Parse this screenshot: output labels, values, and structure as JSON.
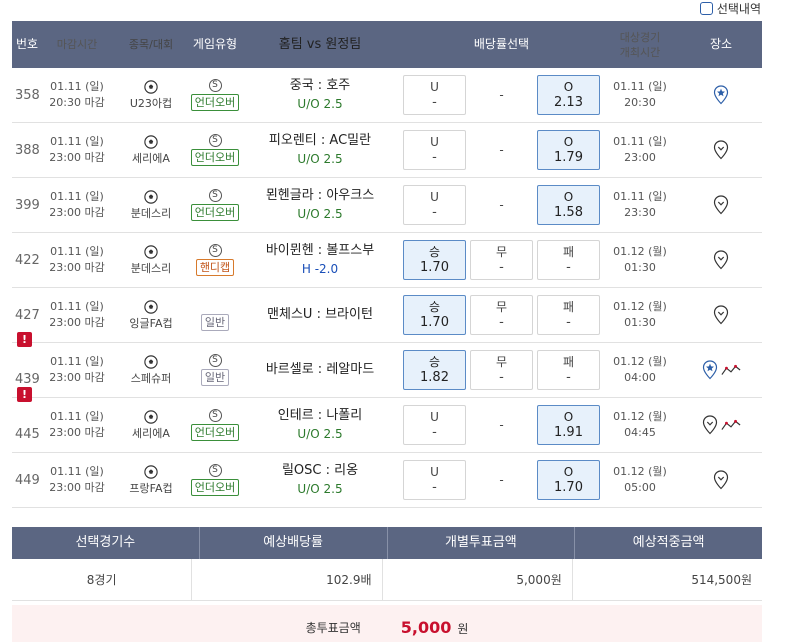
{
  "top_checkbox_label": "선택내역",
  "headers": {
    "num": "번호",
    "close": "마감시간",
    "sport": "종목/대회",
    "type": "게임유형",
    "teams": "홈팀 vs 원정팀",
    "odds": "배당률선택",
    "date_line1": "대상경기",
    "date_line2": "개최시간",
    "fav": "장소"
  },
  "rows": [
    {
      "num": "358",
      "warn": false,
      "close_date": "01.11 (일)",
      "close_time": "20:30 마감",
      "league": "U23아컵",
      "type_icon": "S",
      "badge": "언더오버",
      "badge_kind": "uo",
      "teams": "중국 : 호주",
      "sub": "U/O 2.5",
      "sub_kind": "uo",
      "odds": [
        {
          "label": "U",
          "value": "-",
          "sel": false
        },
        {
          "label": "-",
          "value": "",
          "sel": false,
          "dash": true
        },
        {
          "label": "O",
          "value": "2.13",
          "sel": true
        }
      ],
      "date": "01.11 (일)",
      "time": "20:30",
      "fav": "star-pin",
      "trend": false
    },
    {
      "num": "388",
      "warn": false,
      "close_date": "01.11 (일)",
      "close_time": "23:00 마감",
      "league": "세리에A",
      "type_icon": "S",
      "badge": "언더오버",
      "badge_kind": "uo",
      "teams": "피오렌티 : AC밀란",
      "sub": "U/O 2.5",
      "sub_kind": "uo",
      "odds": [
        {
          "label": "U",
          "value": "-",
          "sel": false
        },
        {
          "label": "-",
          "value": "",
          "sel": false,
          "dash": true
        },
        {
          "label": "O",
          "value": "1.79",
          "sel": true
        }
      ],
      "date": "01.11 (일)",
      "time": "23:00",
      "fav": "pin",
      "trend": false
    },
    {
      "num": "399",
      "warn": false,
      "close_date": "01.11 (일)",
      "close_time": "23:00 마감",
      "league": "분데스리",
      "type_icon": "S",
      "badge": "언더오버",
      "badge_kind": "uo",
      "teams": "묀헨글라 : 아우크스",
      "sub": "U/O 2.5",
      "sub_kind": "uo",
      "odds": [
        {
          "label": "U",
          "value": "-",
          "sel": false
        },
        {
          "label": "-",
          "value": "",
          "sel": false,
          "dash": true
        },
        {
          "label": "O",
          "value": "1.58",
          "sel": true
        }
      ],
      "date": "01.11 (일)",
      "time": "23:30",
      "fav": "pin",
      "trend": false
    },
    {
      "num": "422",
      "warn": false,
      "close_date": "01.11 (일)",
      "close_time": "23:00 마감",
      "league": "분데스리",
      "type_icon": "S",
      "badge": "핸디캡",
      "badge_kind": "hc",
      "teams": "바이뮌헨 : 볼프스부",
      "sub": "H -2.0",
      "sub_kind": "hc",
      "odds": [
        {
          "label": "승",
          "value": "1.70",
          "sel": true
        },
        {
          "label": "무",
          "value": "-",
          "sel": false
        },
        {
          "label": "패",
          "value": "-",
          "sel": false
        }
      ],
      "date": "01.12 (월)",
      "time": "01:30",
      "fav": "pin",
      "trend": false
    },
    {
      "num": "427",
      "warn": false,
      "close_date": "01.11 (일)",
      "close_time": "23:00 마감",
      "league": "잉글FA컵",
      "type_icon": "",
      "badge": "일반",
      "badge_kind": "plain",
      "teams": "맨체스U : 브라이턴",
      "sub": "",
      "sub_kind": "",
      "odds": [
        {
          "label": "승",
          "value": "1.70",
          "sel": true
        },
        {
          "label": "무",
          "value": "-",
          "sel": false
        },
        {
          "label": "패",
          "value": "-",
          "sel": false
        }
      ],
      "date": "01.12 (월)",
      "time": "01:30",
      "fav": "pin",
      "trend": false
    },
    {
      "num": "439",
      "warn": true,
      "close_date": "01.11 (일)",
      "close_time": "23:00 마감",
      "league": "스페슈퍼",
      "type_icon": "S",
      "badge": "일반",
      "badge_kind": "plain",
      "teams": "바르셀로 : 레알마드",
      "sub": "",
      "sub_kind": "",
      "odds": [
        {
          "label": "승",
          "value": "1.82",
          "sel": true
        },
        {
          "label": "무",
          "value": "-",
          "sel": false
        },
        {
          "label": "패",
          "value": "-",
          "sel": false
        }
      ],
      "date": "01.12 (월)",
      "time": "04:00",
      "fav": "star-pin",
      "trend": true
    },
    {
      "num": "445",
      "warn": true,
      "close_date": "01.11 (일)",
      "close_time": "23:00 마감",
      "league": "세리에A",
      "type_icon": "S",
      "badge": "언더오버",
      "badge_kind": "uo",
      "teams": "인테르 : 나폴리",
      "sub": "U/O 2.5",
      "sub_kind": "uo",
      "odds": [
        {
          "label": "U",
          "value": "-",
          "sel": false
        },
        {
          "label": "-",
          "value": "",
          "sel": false,
          "dash": true
        },
        {
          "label": "O",
          "value": "1.91",
          "sel": true
        }
      ],
      "date": "01.12 (월)",
      "time": "04:45",
      "fav": "pin",
      "trend": true
    },
    {
      "num": "449",
      "warn": false,
      "close_date": "01.11 (일)",
      "close_time": "23:00 마감",
      "league": "프랑FA컵",
      "type_icon": "S",
      "badge": "언더오버",
      "badge_kind": "uo",
      "teams": "릴OSC : 리옹",
      "sub": "U/O 2.5",
      "sub_kind": "uo",
      "odds": [
        {
          "label": "U",
          "value": "-",
          "sel": false
        },
        {
          "label": "-",
          "value": "",
          "sel": false,
          "dash": true
        },
        {
          "label": "O",
          "value": "1.70",
          "sel": true
        }
      ],
      "date": "01.12 (월)",
      "time": "05:00",
      "fav": "pin",
      "trend": false
    }
  ],
  "summary": {
    "headers": [
      "선택경기수",
      "예상배당률",
      "개별투표금액",
      "예상적중금액"
    ],
    "values": [
      "8경기",
      "102.9배",
      "5,000원",
      "514,500원"
    ],
    "total_label": "총투표금액",
    "total_amount": "5,000",
    "total_unit": "원"
  },
  "colors": {
    "header_bg": "#5b6682",
    "selected_bg": "#e7f1fb",
    "warn": "#c8102e",
    "uo": "#2c7a2c",
    "handicap": "#c2551a"
  }
}
